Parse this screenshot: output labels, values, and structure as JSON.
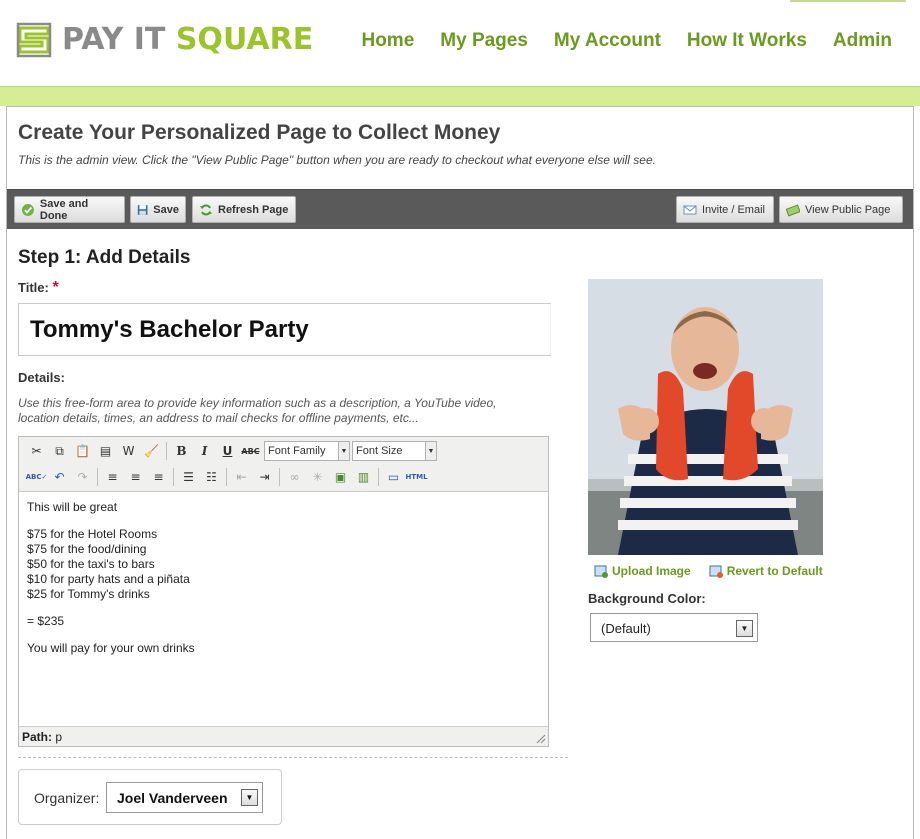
{
  "header": {
    "logo": {
      "word1": "PAY IT",
      "word2": "SQUARE"
    },
    "nav": [
      "Home",
      "My Pages",
      "My Account",
      "How It Works",
      "Admin"
    ]
  },
  "page": {
    "title": "Create Your Personalized Page to Collect Money",
    "subtitle": "This is the admin view. Click the \"View Public Page\" button when you are ready to checkout what everyone else will see."
  },
  "toolbar": {
    "save_done": "Save and Done",
    "save": "Save",
    "refresh": "Refresh Page",
    "invite": "Invite / Email",
    "view_public": "View Public Page"
  },
  "step": {
    "heading": "Step 1: Add Details",
    "title_label": "Title:",
    "required_mark": "*",
    "title_value": "Tommy's Bachelor Party",
    "details_label": "Details:",
    "details_help": "Use this free-form area to provide key information such as a description, a YouTube video, location details, times, an address to mail checks for offline payments, etc..."
  },
  "editor": {
    "font_family": "Font Family",
    "font_size": "Font Size",
    "html_btn": "HTML",
    "lines": [
      "This will be great",
      "",
      "$75 for the Hotel Rooms",
      "$75 for the food/dining",
      "$50 for the taxi's to bars",
      "$10 for party hats and a piñata",
      "$25 for Tommy's drinks",
      "",
      "= $235",
      "",
      "You will pay for your own drinks"
    ],
    "path_label": "Path:",
    "path_value": "p"
  },
  "organizer": {
    "label": "Organizer:",
    "value": "Joel Vanderveen"
  },
  "image": {
    "upload": "Upload Image",
    "revert": "Revert to Default"
  },
  "background": {
    "label": "Background Color:",
    "value": "(Default)"
  },
  "colors": {
    "brand_green": "#6a9a1f",
    "band_green": "#d6ec96",
    "toolbar_gray": "#5a5a5a"
  }
}
